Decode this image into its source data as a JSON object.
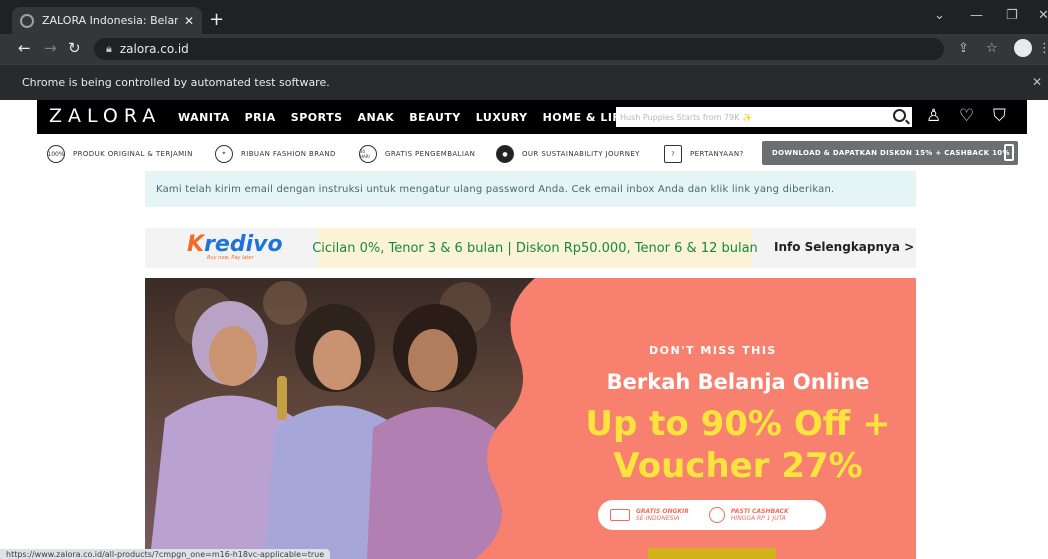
{
  "browser": {
    "tab_title": "ZALORA Indonesia: Belanja Onlin",
    "url": "zalora.co.id",
    "infobar": "Chrome is being controlled by automated test software.",
    "status_url": "https://www.zalora.co.id/all-products/?cmpgn_one=m16-h18vc-applicable=true"
  },
  "header": {
    "logo": "ZALORA",
    "nav": [
      "WANITA",
      "PRIA",
      "SPORTS",
      "ANAK",
      "BEAUTY",
      "LUXURY",
      "HOME & LIFESTYLE"
    ],
    "search_placeholder": "Hush Puppies Starts from 79K ✨"
  },
  "usp": {
    "items": [
      {
        "icon": "100%",
        "label": "PRODUK ORIGINAL & TERJAMIN"
      },
      {
        "icon": "tag",
        "label": "RIBUAN FASHION BRAND"
      },
      {
        "icon": "30 HARI",
        "label": "GRATIS PENGEMBALIAN"
      },
      {
        "icon": "globe",
        "label": "OUR SUSTAINABILITY JOURNEY"
      },
      {
        "icon": "?",
        "label": "PERTANYAAN?"
      }
    ],
    "download_label": "DOWNLOAD & DAPATKAN DISKON 15% + CASHBACK 10%"
  },
  "notice": {
    "text": "Kami telah kirim email dengan instruksi untuk mengatur ulang password Anda. Cek email inbox Anda dan klik link yang diberikan."
  },
  "kredivo": {
    "logo": "redivo",
    "logo_initial": "K",
    "tagline": "Buy now, Pay later",
    "offer": "Cicilan 0%, Tenor 3 & 6 bulan | Diskon Rp50.000, Tenor 6 & 12 bulan",
    "cta": "Info Selengkapnya >"
  },
  "hero": {
    "eyebrow": "DON'T MISS THIS",
    "title": "Berkah Belanja Online",
    "offer_line1": "Up to 90% Off +",
    "offer_line2": "Voucher 27%",
    "badge1_title": "GRATIS ONGKIR",
    "badge1_sub": "SE-INDONESIA",
    "badge2_title": "PASTI CASHBACK",
    "badge2_sub": "HINGGA RP 1 JUTA"
  },
  "colors": {
    "hero_bg": "#f7806f",
    "hero_accent": "#fbe43d",
    "notice_bg": "#e5f4f4",
    "kredivo_offer": "#148a3c"
  }
}
